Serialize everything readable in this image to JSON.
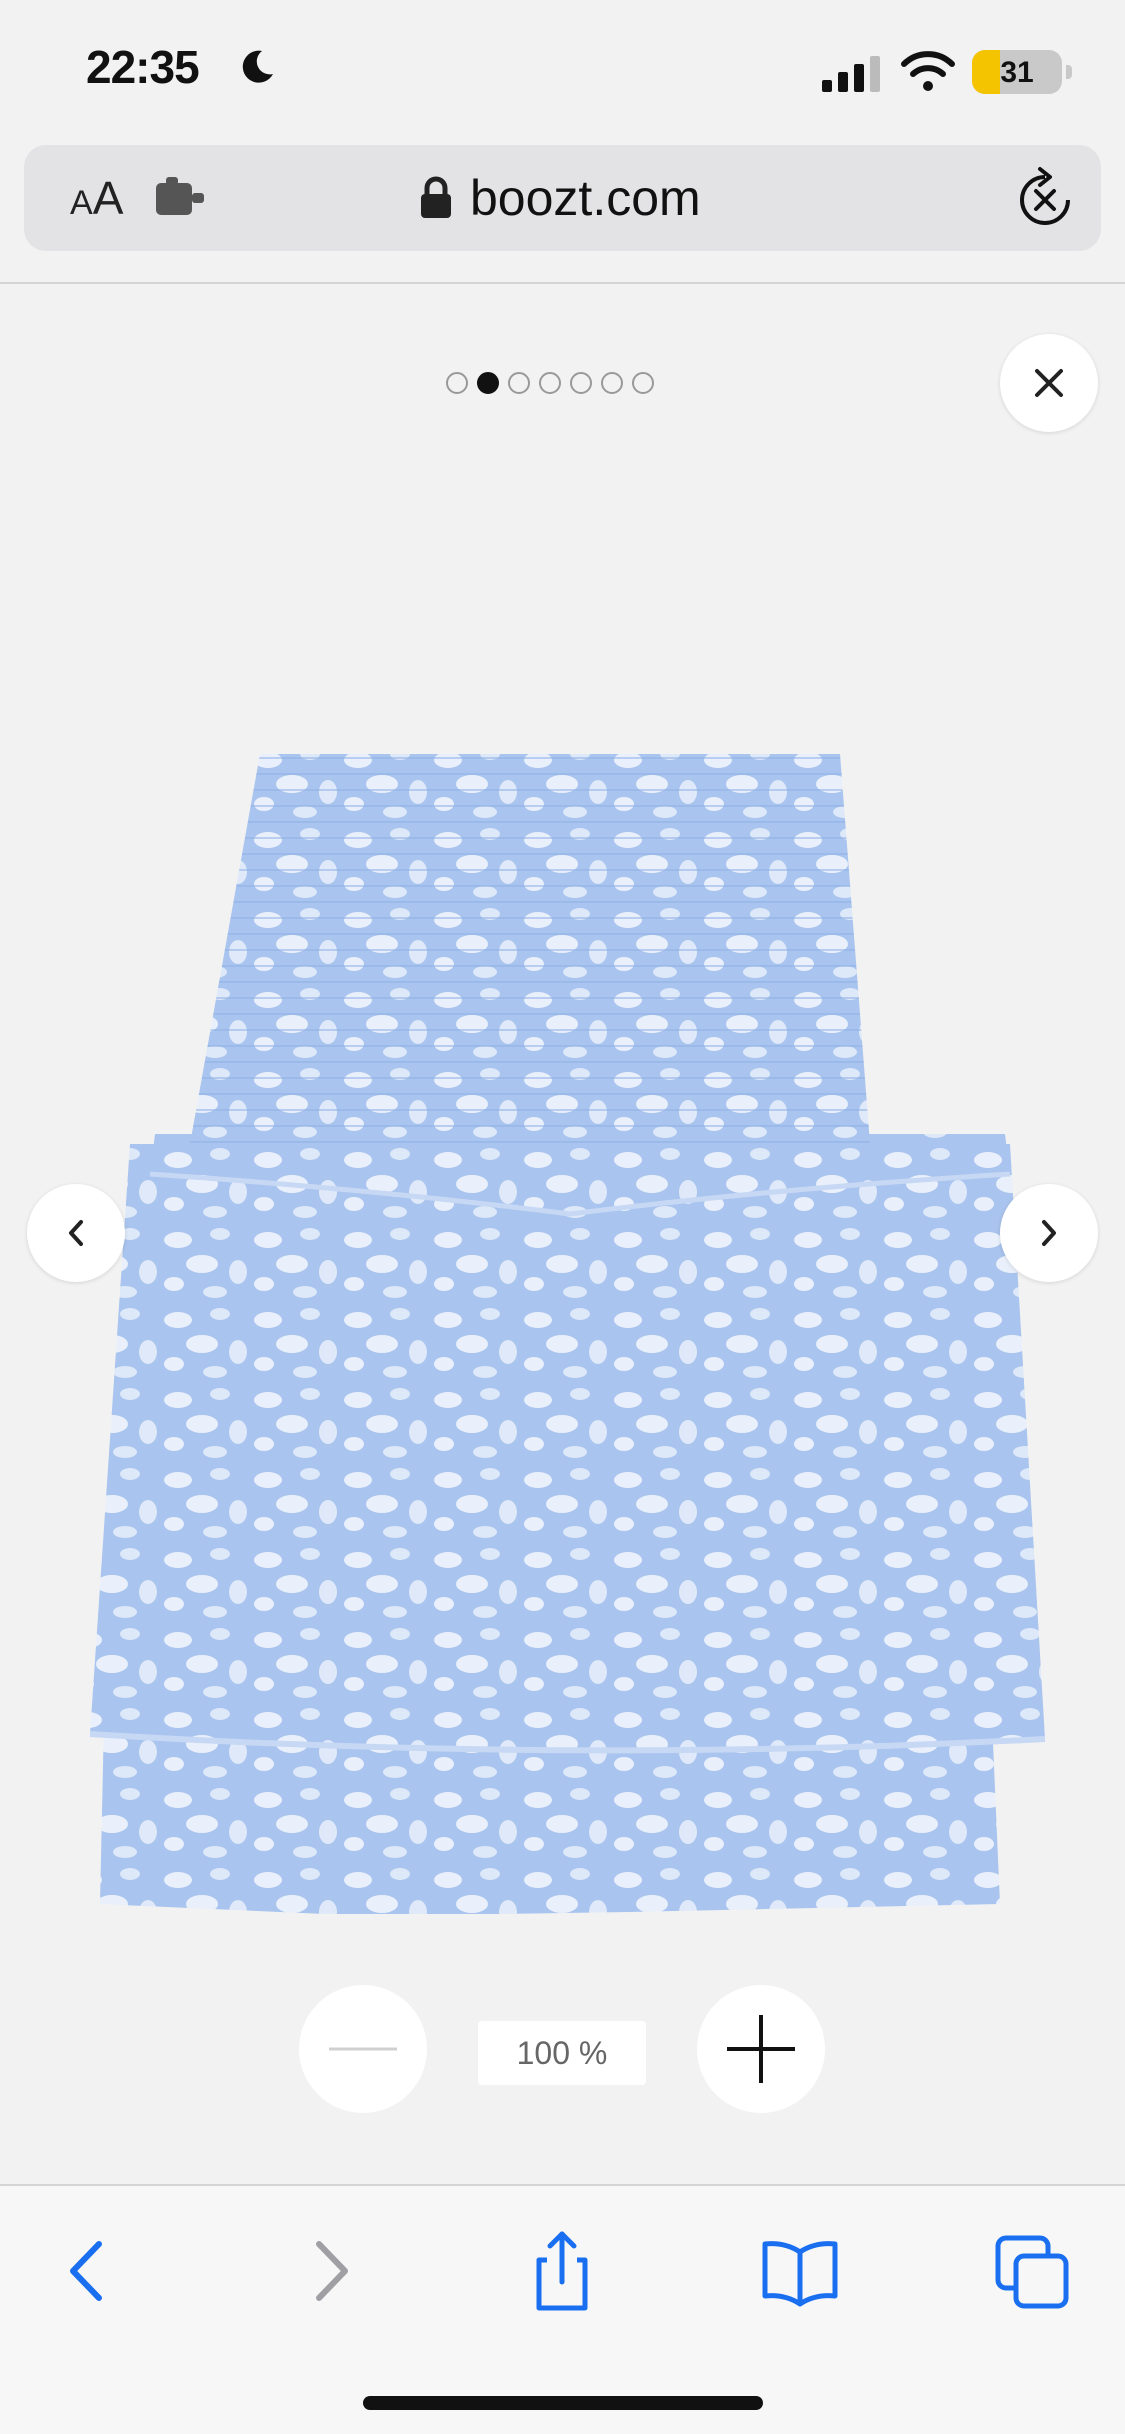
{
  "status_bar": {
    "time": "22:35",
    "battery_level": "31",
    "battery_fraction": 0.31,
    "colors": {
      "battery_fill": "#f5c400"
    },
    "icons": [
      "moon-icon",
      "cellular-signal-icon",
      "wifi-icon",
      "battery-icon"
    ]
  },
  "address_bar": {
    "text_size_label_small": "A",
    "text_size_label_large": "A",
    "url": "boozt.com",
    "icons": [
      "extension-icon",
      "lock-icon",
      "reload-icon"
    ]
  },
  "gallery": {
    "image_count": 7,
    "active_index": 1,
    "product_image": "blue floral print tiered smocked mini skirt",
    "colors": {
      "skirt_base": "#a9c4ee",
      "skirt_print": "#e9f0fb"
    },
    "zoom_level": "100 %",
    "icons": [
      "close-icon",
      "chevron-left-icon",
      "chevron-right-icon",
      "minus-icon",
      "plus-icon"
    ]
  },
  "toolbar": {
    "icons": [
      "back-icon",
      "forward-icon",
      "share-icon",
      "bookmarks-icon",
      "tabs-icon"
    ],
    "colors": {
      "active": "#1a6ff0",
      "disabled": "#a0a0a4"
    }
  }
}
